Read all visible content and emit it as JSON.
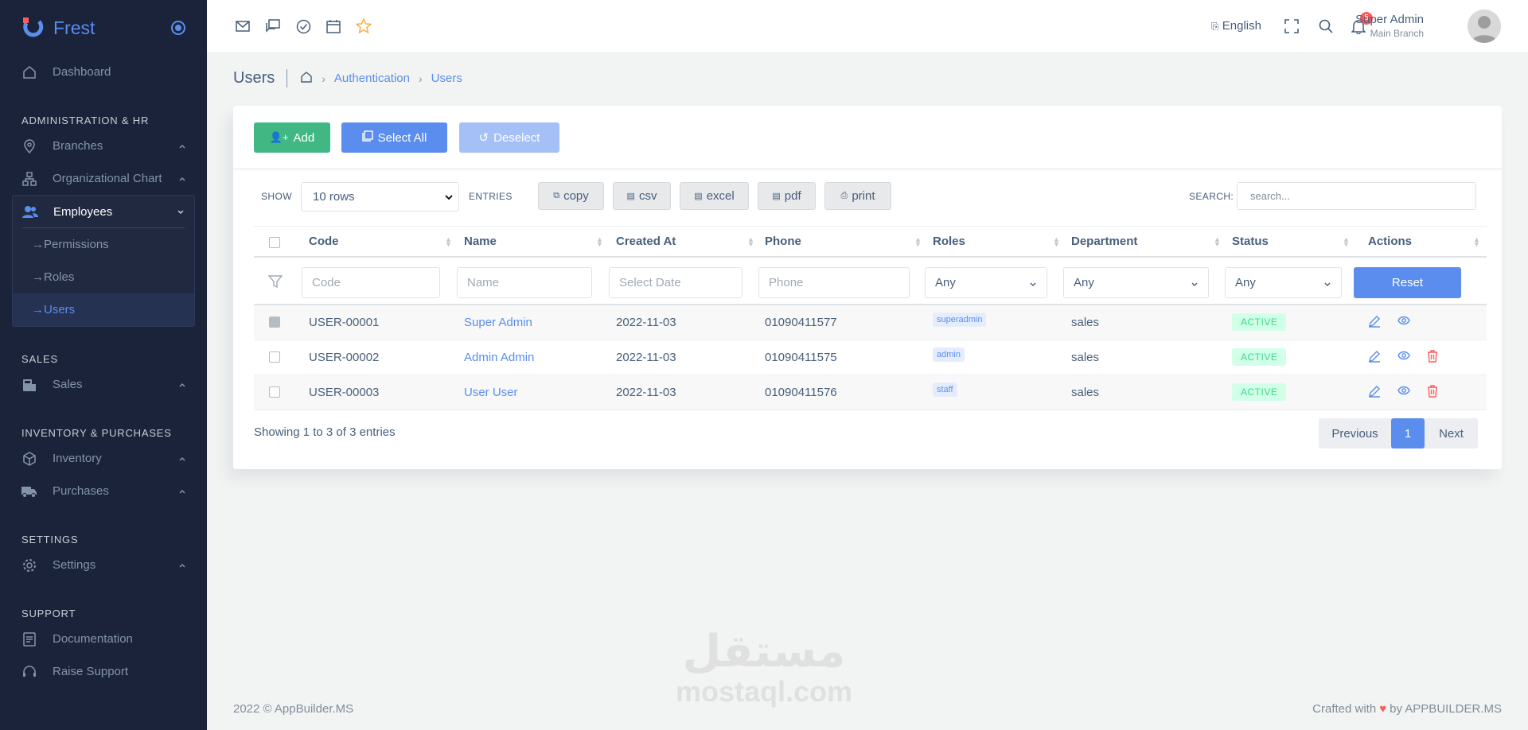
{
  "brand": {
    "name": "Frest",
    "accent": "#5a8dee"
  },
  "sidebar": {
    "dashboard": "Dashboard",
    "section_admin": "ADMINISTRATION & HR",
    "branches": "Branches",
    "org_chart": "Organizational Chart",
    "employees": "Employees",
    "permissions": "Permissions",
    "roles": "Roles",
    "users": "Users",
    "section_sales": "SALES",
    "sales": "Sales",
    "section_inventory": "INVENTORY & PURCHASES",
    "inventory": "Inventory",
    "purchases": "Purchases",
    "section_settings": "SETTINGS",
    "settings": "Settings",
    "section_support": "SUPPORT",
    "documentation": "Documentation",
    "raise_support": "Raise Support"
  },
  "topbar": {
    "language": "English",
    "notifications": "5",
    "user_name": "Super Admin",
    "user_branch": "Main Branch"
  },
  "breadcrumb": {
    "page_title": "Users",
    "items": [
      "Authentication",
      "Users"
    ]
  },
  "actions": {
    "add": "Add",
    "select_all": "Select All",
    "deselect": "Deselect"
  },
  "toolbar": {
    "show_label": "SHOW",
    "rows_value": "10 rows",
    "entries_label": "ENTRIES",
    "copy": "copy",
    "csv": "csv",
    "excel": "excel",
    "pdf": "pdf",
    "print": "print",
    "search_label": "SEARCH:",
    "search_placeholder": "search..."
  },
  "table": {
    "columns": [
      "Code",
      "Name",
      "Created At",
      "Phone",
      "Roles",
      "Department",
      "Status",
      "Actions"
    ],
    "filters": {
      "code": "Code",
      "name": "Name",
      "created": "Select Date",
      "phone": "Phone",
      "roles": "Any",
      "department": "Any",
      "status": "Any",
      "reset": "Reset"
    },
    "rows": [
      {
        "code": "USER-00001",
        "name": "Super Admin",
        "created": "2022-11-03",
        "phone": "01090411577",
        "role": "superadmin",
        "department": "sales",
        "status": "ACTIVE"
      },
      {
        "code": "USER-00002",
        "name": "Admin Admin",
        "created": "2022-11-03",
        "phone": "01090411575",
        "role": "admin",
        "department": "sales",
        "status": "ACTIVE"
      },
      {
        "code": "USER-00003",
        "name": "User User",
        "created": "2022-11-03",
        "phone": "01090411576",
        "role": "staff",
        "department": "sales",
        "status": "ACTIVE"
      }
    ]
  },
  "pagination": {
    "showing": "Showing 1 to 3 of 3 entries",
    "previous": "Previous",
    "page": "1",
    "next": "Next"
  },
  "footer": {
    "copyright": "2022 © AppBuilder.MS",
    "crafted": "Crafted with",
    "by": "by",
    "builder": "APPBUILDER.MS"
  },
  "watermark": {
    "arabic": "مستقل",
    "latin": "mostaql.com"
  }
}
